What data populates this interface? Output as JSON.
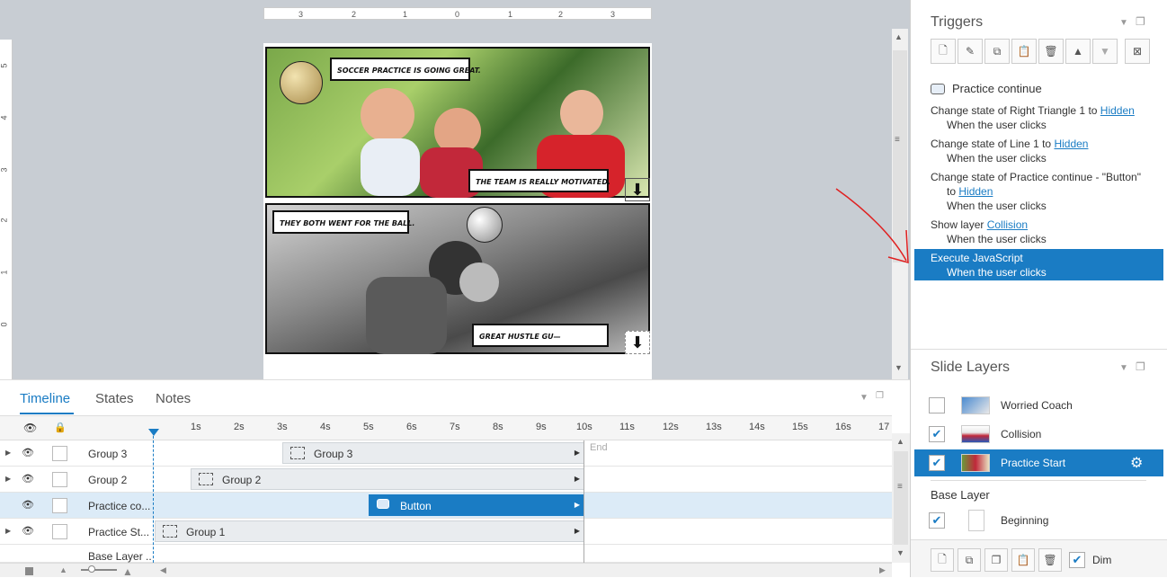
{
  "canvas": {
    "ruler_top": [
      "3",
      "2",
      "1",
      "0",
      "1",
      "2",
      "3"
    ],
    "ruler_left": [
      "5",
      "4",
      "3",
      "2",
      "1",
      "0"
    ],
    "slide": {
      "bubble1": "Soccer practice is going great.",
      "bubble2": "The team is really motivated.",
      "bubble3": "They both went for the ball.",
      "bubble4": "Great hustle gu—"
    }
  },
  "timeline": {
    "tabs": [
      "Timeline",
      "States",
      "Notes"
    ],
    "active_tab": "Timeline",
    "seconds": [
      "1s",
      "2s",
      "3s",
      "4s",
      "5s",
      "6s",
      "7s",
      "8s",
      "9s",
      "10s",
      "11s",
      "12s",
      "13s",
      "14s",
      "15s",
      "16s",
      "17"
    ],
    "end_label": "End",
    "rows": [
      {
        "name": "Group 3",
        "bar": "Group  3"
      },
      {
        "name": "Group 2",
        "bar": "Group  2"
      },
      {
        "name": "Practice co...",
        "bar": "Button"
      },
      {
        "name": "Practice St...",
        "bar": "Group  1"
      },
      {
        "name": "Base Layer ..."
      }
    ]
  },
  "triggers": {
    "title": "Triggers",
    "object_name": "Practice continue",
    "items": [
      {
        "pre": "Change state of Right Triangle 1 to",
        "link": "Hidden",
        "when": "When the user clicks"
      },
      {
        "pre": "Change state of Line 1 to",
        "link": "Hidden",
        "when": "When the user clicks"
      },
      {
        "pre": "Change state of Practice continue - \"Button\"",
        "pre2": "to",
        "link": "Hidden",
        "when": "When the user clicks"
      },
      {
        "pre": "Show layer",
        "link": "Collision",
        "when": "When the user clicks"
      },
      {
        "pre": "Execute JavaScript",
        "when": "When the user clicks"
      }
    ]
  },
  "layers": {
    "title": "Slide Layers",
    "items": [
      {
        "name": "Worried Coach",
        "checked": false
      },
      {
        "name": "Collision",
        "checked": true
      },
      {
        "name": "Practice Start",
        "checked": true
      }
    ],
    "base_label": "Base Layer",
    "base_item": "Beginning",
    "dim_label": "Dim"
  },
  "colors": {
    "accent": "#1a7cc4",
    "annotation": "#e02020"
  }
}
